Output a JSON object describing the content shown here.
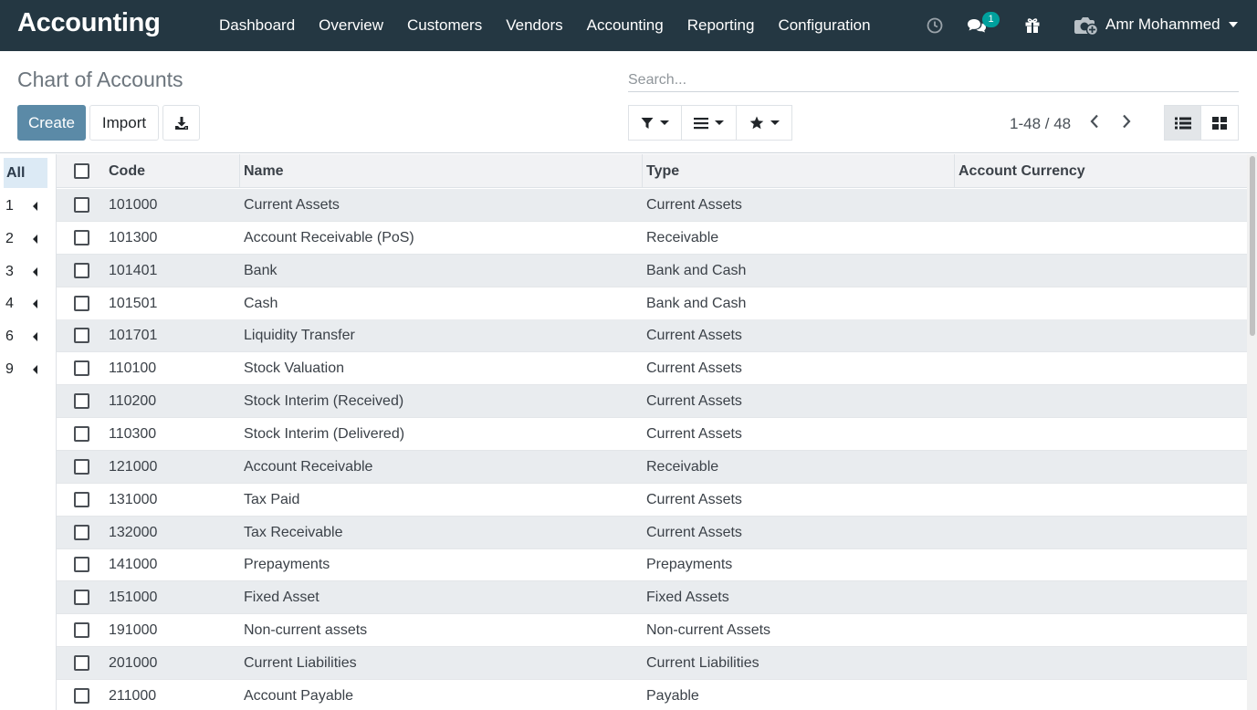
{
  "app": {
    "title": "Accounting"
  },
  "nav": {
    "menu": [
      "Dashboard",
      "Overview",
      "Customers",
      "Vendors",
      "Accounting",
      "Reporting",
      "Configuration"
    ],
    "messages_badge": "1",
    "user_name": "Amr Mohammed",
    "icons": [
      "clock-icon",
      "chat-icon",
      "gift-icon",
      "camera-plus-icon"
    ]
  },
  "control_panel": {
    "breadcrumb": "Chart of Accounts",
    "search_placeholder": "Search...",
    "create_label": "Create",
    "import_label": "Import",
    "pager": "1-48 / 48"
  },
  "side_panel": {
    "all_label": "All",
    "groups": [
      "1",
      "2",
      "3",
      "4",
      "6",
      "9"
    ]
  },
  "table": {
    "columns": [
      "Code",
      "Name",
      "Type",
      "Account Currency"
    ],
    "rows": [
      {
        "code": "101000",
        "name": "Current Assets",
        "type": "Current Assets",
        "currency": ""
      },
      {
        "code": "101300",
        "name": "Account Receivable (PoS)",
        "type": "Receivable",
        "currency": ""
      },
      {
        "code": "101401",
        "name": "Bank",
        "type": "Bank and Cash",
        "currency": ""
      },
      {
        "code": "101501",
        "name": "Cash",
        "type": "Bank and Cash",
        "currency": ""
      },
      {
        "code": "101701",
        "name": "Liquidity Transfer",
        "type": "Current Assets",
        "currency": ""
      },
      {
        "code": "110100",
        "name": "Stock Valuation",
        "type": "Current Assets",
        "currency": ""
      },
      {
        "code": "110200",
        "name": "Stock Interim (Received)",
        "type": "Current Assets",
        "currency": ""
      },
      {
        "code": "110300",
        "name": "Stock Interim (Delivered)",
        "type": "Current Assets",
        "currency": ""
      },
      {
        "code": "121000",
        "name": "Account Receivable",
        "type": "Receivable",
        "currency": ""
      },
      {
        "code": "131000",
        "name": "Tax Paid",
        "type": "Current Assets",
        "currency": ""
      },
      {
        "code": "132000",
        "name": "Tax Receivable",
        "type": "Current Assets",
        "currency": ""
      },
      {
        "code": "141000",
        "name": "Prepayments",
        "type": "Prepayments",
        "currency": ""
      },
      {
        "code": "151000",
        "name": "Fixed Asset",
        "type": "Fixed Assets",
        "currency": ""
      },
      {
        "code": "191000",
        "name": "Non-current assets",
        "type": "Non-current Assets",
        "currency": ""
      },
      {
        "code": "201000",
        "name": "Current Liabilities",
        "type": "Current Liabilities",
        "currency": ""
      },
      {
        "code": "211000",
        "name": "Account Payable",
        "type": "Payable",
        "currency": ""
      }
    ]
  },
  "colors": {
    "navbar": "#243742",
    "primary": "#5b8aa7",
    "badge": "#00a09d",
    "row_stripe": "#e9ecef",
    "selected_group": "#dceaf5"
  }
}
